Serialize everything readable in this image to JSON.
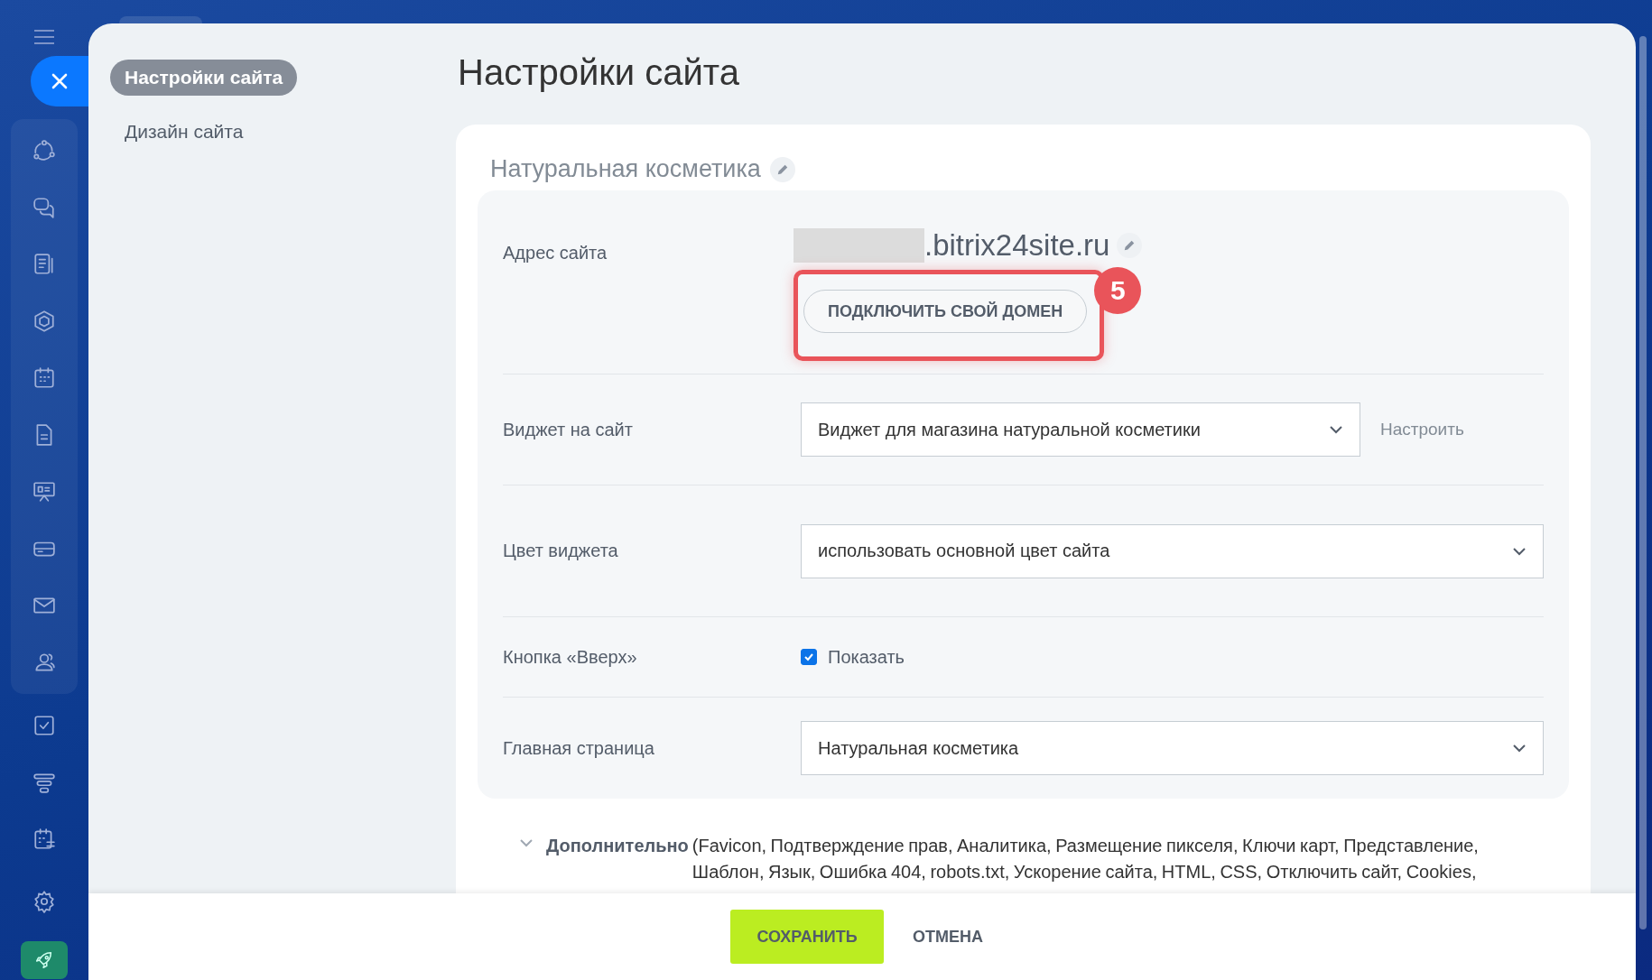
{
  "nav": [
    {
      "label": "Настройки сайта",
      "selected": true
    },
    {
      "label": "Дизайн сайта",
      "selected": false
    }
  ],
  "title": "Настройки сайта",
  "site_name": "Натуральная косметика",
  "address": {
    "label": "Адрес сайта",
    "domain_suffix": ".bitrix24site.ru",
    "connect_button": "ПОДКЛЮЧИТЬ СВОЙ ДОМЕН",
    "step_badge": "5"
  },
  "rows": [
    {
      "kind": "select",
      "label": "Виджет на сайт",
      "value": "Виджет для магазина натуральной косметики",
      "action": "Настроить"
    },
    {
      "kind": "select",
      "label": "Цвет виджета",
      "value": "использовать основной цвет сайта"
    },
    {
      "kind": "checkbox",
      "label": "Кнопка «Вверх»",
      "option": "Показать",
      "checked": true
    },
    {
      "kind": "select",
      "label": "Главная страница",
      "value": "Натуральная косметика"
    }
  ],
  "additional": {
    "expanded": true,
    "title": "Дополнительно",
    "text": "(Favicon,  Подтверждение прав,  Аналитика,  Размещение пикселя,  Ключи карт,  Представление, Шаблон,  Язык,  Ошибка 404,  robots.txt,  Ускорение сайта,  HTML,  CSS,  Отключить сайт,  Cookies,"
  },
  "footer": {
    "save": "СОХРАНИТЬ",
    "cancel": "ОТМЕНА"
  }
}
